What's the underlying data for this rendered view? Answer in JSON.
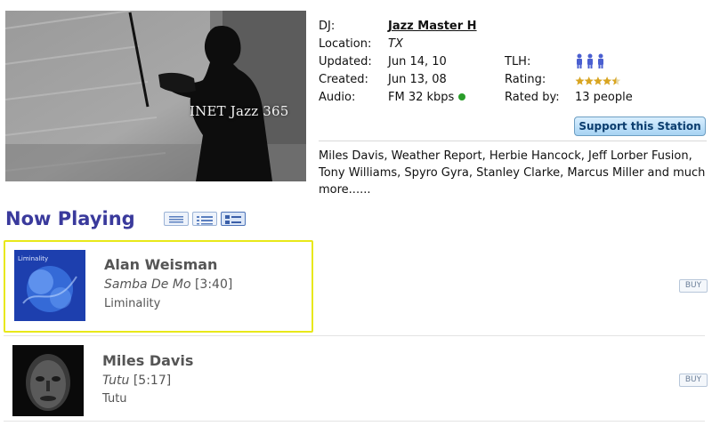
{
  "station": {
    "art_caption": "INET Jazz 365",
    "labels": {
      "dj": "DJ:",
      "location": "Location:",
      "updated": "Updated:",
      "created": "Created:",
      "audio": "Audio:",
      "tlh": "TLH:",
      "rating": "Rating:",
      "rated_by": "Rated by:"
    },
    "dj_name": "Jazz Master H",
    "location": "TX",
    "updated": "Jun 14, 10",
    "created": "Jun 13, 08",
    "audio": "FM 32 kbps",
    "audio_status_color": "#2a9d2a",
    "tlh_icon": "three-listeners-icon",
    "rating_stars": 4.5,
    "rating_max": 5,
    "rated_by": "13 people",
    "support_label": "Support this Station",
    "description": "Miles Davis, Weather Report, Herbie Hancock, Jeff Lorber Fusion, Tony Williams, Spyro Gyra, Stanley Clarke, Marcus Miller and much more......"
  },
  "now_playing": {
    "heading": "Now Playing",
    "view_icons": [
      "list-view-icon",
      "compact-view-icon",
      "detail-view-icon"
    ],
    "tracks": [
      {
        "artist": "Alan Weisman",
        "song": "Samba De Mo",
        "duration": "[3:40]",
        "album": "Liminality",
        "cover_text": "Liminality",
        "buy": "BUY"
      },
      {
        "artist": "Miles Davis",
        "song": "Tutu",
        "duration": "[5:17]",
        "album": "Tutu",
        "buy": "BUY"
      }
    ]
  },
  "colors": {
    "heading": "#3a3a9c",
    "highlight_border": "#e8e81a",
    "support_button": "#a7d3f3"
  }
}
